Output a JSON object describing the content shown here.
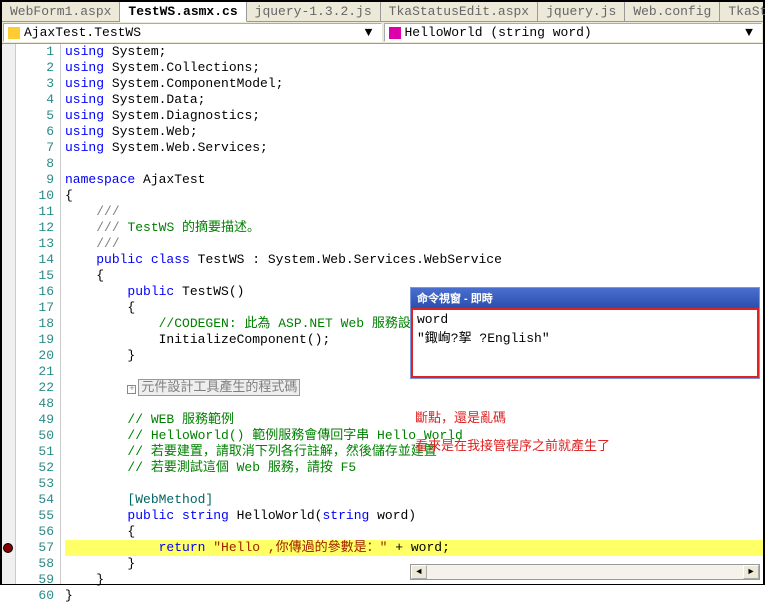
{
  "tabs": [
    "WebForm1.aspx",
    "TestWS.asmx.cs",
    "jquery-1.3.2.js",
    "TkaStatusEdit.aspx",
    "jquery.js",
    "Web.config",
    "TkaStatusEditService.asmx.cs"
  ],
  "activeTab": 1,
  "dropdown1": "AjaxTest.TestWS",
  "dropdown2": "HelloWorld (string word)",
  "lines": [
    {
      "n": 1,
      "t": "using",
      "r": " System;"
    },
    {
      "n": 2,
      "t": "using",
      "r": " System.Collections;"
    },
    {
      "n": 3,
      "t": "using",
      "r": " System.ComponentModel;"
    },
    {
      "n": 4,
      "t": "using",
      "r": " System.Data;"
    },
    {
      "n": 5,
      "t": "using",
      "r": " System.Diagnostics;"
    },
    {
      "n": 6,
      "t": "using",
      "r": " System.Web;"
    },
    {
      "n": 7,
      "t": "using",
      "r": " System.Web.Services;"
    },
    {
      "n": 8,
      "t": "",
      "r": ""
    },
    {
      "n": 9,
      "t": "namespace",
      "r": " AjaxTest"
    },
    {
      "n": 10,
      "t": "",
      "r": "{"
    },
    {
      "n": 11,
      "t": "",
      "r": "    /// ",
      "c": "<summary>"
    },
    {
      "n": 12,
      "t": "",
      "r": "    /// ",
      "c": "TestWS 的摘要描述。"
    },
    {
      "n": 13,
      "t": "",
      "r": "    /// ",
      "c": "</summary>"
    },
    {
      "n": 14,
      "kw": "public class",
      "cl": " TestWS : System.Web.Services.WebService"
    },
    {
      "n": 15,
      "t": "",
      "r": "    {"
    },
    {
      "n": 16,
      "kw": "        public",
      "r": " TestWS()"
    },
    {
      "n": 17,
      "t": "",
      "r": "        {"
    },
    {
      "n": 18,
      "com": "            //CODEGEN: 此為 ASP.NET Web 服務設計工具所需的呼叫。"
    },
    {
      "n": 19,
      "t": "",
      "r": "            InitializeComponent();"
    },
    {
      "n": 20,
      "t": "",
      "r": "        }"
    },
    {
      "n": 21,
      "t": "",
      "r": ""
    },
    {
      "n": 22,
      "box": "元件設計工具產生的程式碼"
    },
    {
      "n": 48,
      "t": "",
      "r": ""
    },
    {
      "n": 49,
      "com": "        // WEB 服務範例"
    },
    {
      "n": 50,
      "com": "        // HelloWorld() 範例服務會傳回字串 Hello World"
    },
    {
      "n": 51,
      "com": "        // 若要建置，請取消下列各行註解，然後儲存並建置"
    },
    {
      "n": 52,
      "com": "        // 若要測試這個 Web 服務，請按 F5"
    },
    {
      "n": 53,
      "t": "",
      "r": ""
    },
    {
      "n": 54,
      "attr": "        [WebMethod]"
    },
    {
      "n": 55,
      "sig": true
    },
    {
      "n": 56,
      "t": "",
      "r": "        {"
    },
    {
      "n": 57,
      "ret": true
    },
    {
      "n": 58,
      "t": "",
      "r": "        }"
    },
    {
      "n": 59,
      "t": "",
      "r": "    }"
    },
    {
      "n": 60,
      "t": "",
      "r": "}"
    }
  ],
  "sig_kw1": "public",
  "sig_kw2": "string",
  "sig_m": " HelloWorld(",
  "sig_kw3": "string",
  "sig_r": " word)",
  "ret_kw": "return",
  "ret_str": " \"Hello ,你傳過的參數是：\" ",
  "ret_r": "+ word;",
  "breakpointLine": 57,
  "immediate": {
    "title": "命令視窗 - 即時",
    "l1": "word",
    "l2": "\"鋷峋?挐  ?English\""
  },
  "annotation": {
    "l1": "斷點，還是亂碼",
    "l2": "看來是在我接管程序之前就產生了"
  }
}
